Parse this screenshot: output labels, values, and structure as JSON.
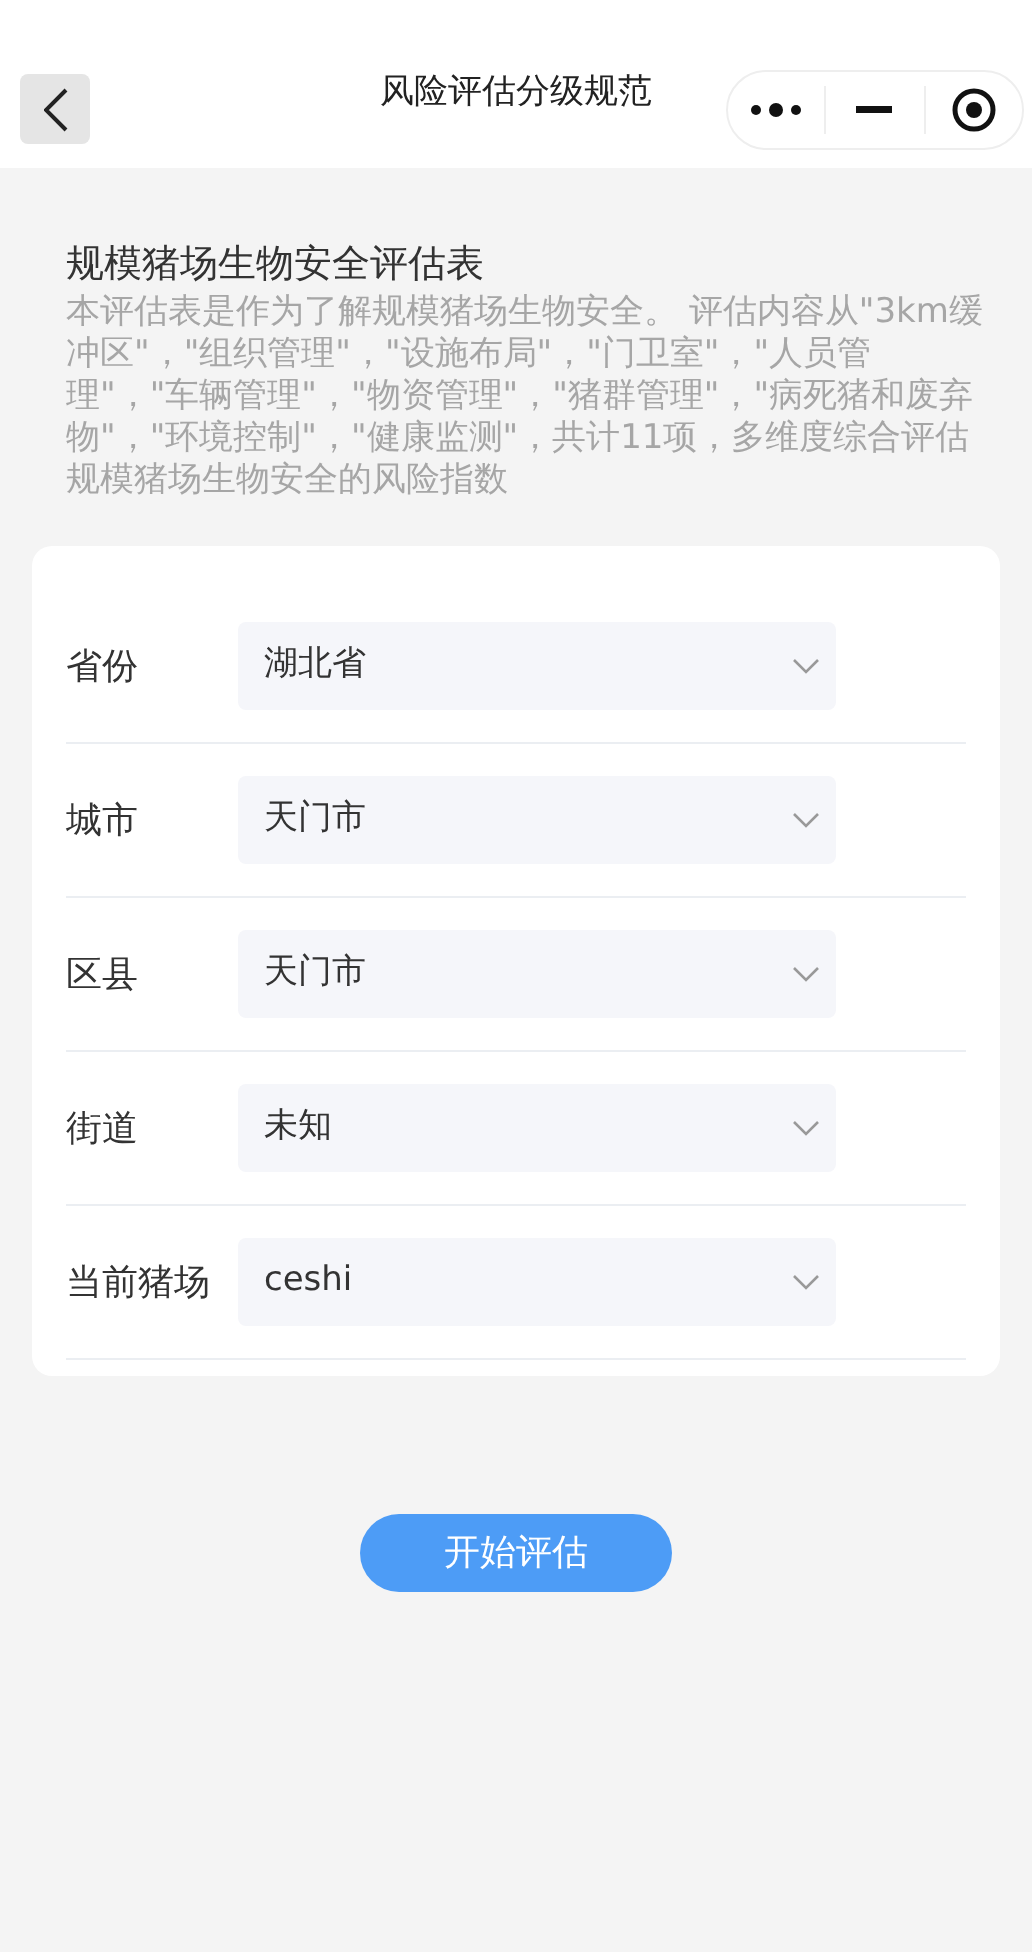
{
  "nav": {
    "title": "风险评估分级规范"
  },
  "intro": {
    "title": "规模猪场生物安全评估表",
    "description": "本评估表是作为了解规模猪场生物安全。 评估内容从\"3km缓冲区\"，\"组织管理\"，\"设施布局\"，\"门卫室\"，\"人员管理\"，\"车辆管理\"，\"物资管理\"，\"猪群管理\"，\"病死猪和废弃物\"，\"环境控制\"，\"健康监测\"，共计11项，多维度综合评估规模猪场生物安全的风险指数"
  },
  "form": [
    {
      "label": "省份",
      "value": "湖北省"
    },
    {
      "label": "城市",
      "value": "天门市"
    },
    {
      "label": "区县",
      "value": "天门市"
    },
    {
      "label": "街道",
      "value": "未知"
    },
    {
      "label": "当前猪场",
      "value": "ceshi"
    }
  ],
  "start_button": "开始评估"
}
